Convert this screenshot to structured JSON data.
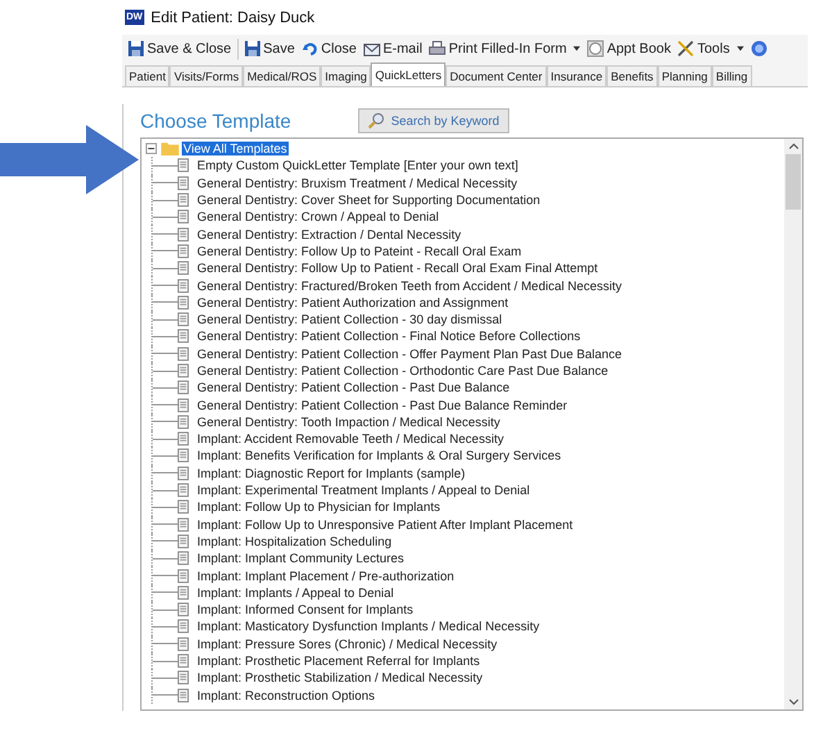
{
  "window": {
    "title": "Edit Patient: Daisy Duck",
    "logo": "DW"
  },
  "toolbar": [
    {
      "label": "Save & Close",
      "kind": "save",
      "dropdown": false
    },
    {
      "label": "Save",
      "kind": "save",
      "dropdown": false
    },
    {
      "label": "Close",
      "kind": "undo",
      "dropdown": false
    },
    {
      "label": "E-mail",
      "kind": "mail",
      "dropdown": false
    },
    {
      "label": "Print Filled-In Form",
      "kind": "print",
      "dropdown": true
    },
    {
      "label": "Appt Book",
      "kind": "clock",
      "dropdown": false
    },
    {
      "label": "Tools",
      "kind": "tools",
      "dropdown": true
    },
    {
      "kind": "help",
      "dropdown": false
    }
  ],
  "tabs": [
    {
      "label": "Patient",
      "selected": false
    },
    {
      "label": "Visits/Forms",
      "selected": false
    },
    {
      "label": "Medical/ROS",
      "selected": false
    },
    {
      "label": "Imaging",
      "selected": false
    },
    {
      "label": "QuickLetters",
      "selected": true
    },
    {
      "label": "Document Center",
      "selected": false
    },
    {
      "label": "Insurance",
      "selected": false
    },
    {
      "label": "Benefits",
      "selected": false
    },
    {
      "label": "Planning",
      "selected": false
    },
    {
      "label": "Billing",
      "selected": false
    }
  ],
  "panel": {
    "heading": "Choose Template",
    "search_button": "Search by Keyword"
  },
  "tree": {
    "label": "View All Templates",
    "expanded": true,
    "selected": true,
    "children": [
      {
        "label": "Empty Custom QuickLetter Template [Enter your own text]",
        "selected": false
      },
      {
        "label": "General Dentistry: Bruxism Treatment / Medical Necessity",
        "selected": false
      },
      {
        "label": "General Dentistry: Cover Sheet  for Supporting Documentation",
        "selected": false
      },
      {
        "label": "General Dentistry: Crown / Appeal to Denial",
        "selected": false
      },
      {
        "label": "General Dentistry: Extraction / Dental Necessity",
        "selected": false
      },
      {
        "label": "General Dentistry: Follow Up to Pateint - Recall Oral Exam",
        "selected": false
      },
      {
        "label": "General Dentistry: Follow Up to Patient - Recall Oral Exam Final Attempt",
        "selected": false
      },
      {
        "label": "General Dentistry: Fractured/Broken Teeth from Accident / Medical Necessity",
        "selected": false
      },
      {
        "label": "General Dentistry: Patient Authorization and Assignment",
        "selected": false
      },
      {
        "label": "General Dentistry: Patient Collection - 30 day dismissal",
        "selected": false
      },
      {
        "label": "General Dentistry: Patient Collection - Final Notice Before Collections",
        "selected": false
      },
      {
        "label": "General Dentistry: Patient Collection - Offer Payment Plan Past Due Balance",
        "selected": false
      },
      {
        "label": "General Dentistry: Patient Collection - Orthodontic Care Past Due Balance",
        "selected": false
      },
      {
        "label": "General Dentistry: Patient Collection - Past Due Balance",
        "selected": false
      },
      {
        "label": "General Dentistry: Patient Collection - Past Due Balance Reminder",
        "selected": false
      },
      {
        "label": "General Dentistry: Tooth Impaction / Medical Necessity",
        "selected": false
      },
      {
        "label": "Implant: Accident Removable Teeth / Medical Necessity",
        "selected": false
      },
      {
        "label": "Implant: Benefits Verification for Implants & Oral Surgery Services",
        "selected": false
      },
      {
        "label": "Implant: Diagnostic Report for Implants (sample)",
        "selected": false
      },
      {
        "label": "Implant: Experimental Treatment Implants / Appeal to Denial",
        "selected": false
      },
      {
        "label": "Implant: Follow Up to Physician for Implants",
        "selected": false
      },
      {
        "label": "Implant: Follow Up to Unresponsive Patient After Implant Placement",
        "selected": false
      },
      {
        "label": "Implant: Hospitalization Scheduling",
        "selected": false
      },
      {
        "label": "Implant: Implant Community Lectures",
        "selected": false
      },
      {
        "label": "Implant: Implant Placement / Pre-authorization",
        "selected": false
      },
      {
        "label": "Implant: Implants / Appeal to Denial",
        "selected": false
      },
      {
        "label": "Implant: Informed Consent for Implants",
        "selected": false
      },
      {
        "label": "Implant: Masticatory Dysfunction Implants / Medical Necessity",
        "selected": false
      },
      {
        "label": "Implant: Pressure Sores (Chronic) / Medical Necessity",
        "selected": false
      },
      {
        "label": "Implant: Prosthetic Placement Referral for Implants",
        "selected": false
      },
      {
        "label": "Implant: Prosthetic Stabilization / Medical Necessity",
        "selected": false
      },
      {
        "label": "Implant: Reconstruction Options",
        "selected": false
      }
    ]
  }
}
